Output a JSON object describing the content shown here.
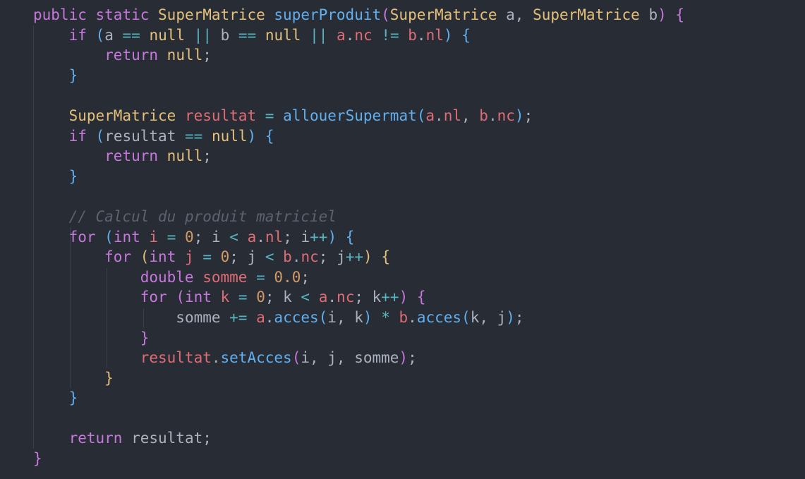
{
  "lines": [
    [
      {
        "t": "public",
        "c": "kw"
      },
      {
        "t": " ",
        "c": "pl"
      },
      {
        "t": "static",
        "c": "kw"
      },
      {
        "t": " ",
        "c": "pl"
      },
      {
        "t": "SuperMatrice",
        "c": "ty"
      },
      {
        "t": " ",
        "c": "pl"
      },
      {
        "t": "superProduit",
        "c": "fn"
      },
      {
        "t": "(",
        "c": "b1"
      },
      {
        "t": "SuperMatrice",
        "c": "ty"
      },
      {
        "t": " a, ",
        "c": "pl"
      },
      {
        "t": "SuperMatrice",
        "c": "ty"
      },
      {
        "t": " b",
        "c": "pl"
      },
      {
        "t": ")",
        "c": "b1"
      },
      {
        "t": " ",
        "c": "pl"
      },
      {
        "t": "{",
        "c": "b1"
      }
    ],
    [
      {
        "t": "    ",
        "c": "pl"
      },
      {
        "t": "if",
        "c": "kw"
      },
      {
        "t": " ",
        "c": "pl"
      },
      {
        "t": "(",
        "c": "b2"
      },
      {
        "t": "a ",
        "c": "pl"
      },
      {
        "t": "==",
        "c": "op"
      },
      {
        "t": " ",
        "c": "pl"
      },
      {
        "t": "null",
        "c": "ty"
      },
      {
        "t": " ",
        "c": "pl"
      },
      {
        "t": "||",
        "c": "op"
      },
      {
        "t": " b ",
        "c": "pl"
      },
      {
        "t": "==",
        "c": "op"
      },
      {
        "t": " ",
        "c": "pl"
      },
      {
        "t": "null",
        "c": "ty"
      },
      {
        "t": " ",
        "c": "pl"
      },
      {
        "t": "||",
        "c": "op"
      },
      {
        "t": " ",
        "c": "pl"
      },
      {
        "t": "a",
        "c": "var"
      },
      {
        "t": ".",
        "c": "pl"
      },
      {
        "t": "nc",
        "c": "var"
      },
      {
        "t": " ",
        "c": "pl"
      },
      {
        "t": "!=",
        "c": "op"
      },
      {
        "t": " ",
        "c": "pl"
      },
      {
        "t": "b",
        "c": "var"
      },
      {
        "t": ".",
        "c": "pl"
      },
      {
        "t": "nl",
        "c": "var"
      },
      {
        "t": ")",
        "c": "b2"
      },
      {
        "t": " ",
        "c": "pl"
      },
      {
        "t": "{",
        "c": "b2"
      }
    ],
    [
      {
        "t": "        ",
        "c": "pl"
      },
      {
        "t": "return",
        "c": "kw"
      },
      {
        "t": " ",
        "c": "pl"
      },
      {
        "t": "null",
        "c": "ty"
      },
      {
        "t": ";",
        "c": "pl"
      }
    ],
    [
      {
        "t": "    ",
        "c": "pl"
      },
      {
        "t": "}",
        "c": "b2"
      }
    ],
    [],
    [
      {
        "t": "    ",
        "c": "pl"
      },
      {
        "t": "SuperMatrice",
        "c": "ty"
      },
      {
        "t": " ",
        "c": "pl"
      },
      {
        "t": "resultat",
        "c": "var"
      },
      {
        "t": " ",
        "c": "pl"
      },
      {
        "t": "=",
        "c": "op"
      },
      {
        "t": " ",
        "c": "pl"
      },
      {
        "t": "allouerSupermat",
        "c": "fn"
      },
      {
        "t": "(",
        "c": "b2"
      },
      {
        "t": "a",
        "c": "var"
      },
      {
        "t": ".",
        "c": "pl"
      },
      {
        "t": "nl",
        "c": "var"
      },
      {
        "t": ", ",
        "c": "pl"
      },
      {
        "t": "b",
        "c": "var"
      },
      {
        "t": ".",
        "c": "pl"
      },
      {
        "t": "nc",
        "c": "var"
      },
      {
        "t": ")",
        "c": "b2"
      },
      {
        "t": ";",
        "c": "pl"
      }
    ],
    [
      {
        "t": "    ",
        "c": "pl"
      },
      {
        "t": "if",
        "c": "kw"
      },
      {
        "t": " ",
        "c": "pl"
      },
      {
        "t": "(",
        "c": "b2"
      },
      {
        "t": "resultat ",
        "c": "pl"
      },
      {
        "t": "==",
        "c": "op"
      },
      {
        "t": " ",
        "c": "pl"
      },
      {
        "t": "null",
        "c": "ty"
      },
      {
        "t": ")",
        "c": "b2"
      },
      {
        "t": " ",
        "c": "pl"
      },
      {
        "t": "{",
        "c": "b2"
      }
    ],
    [
      {
        "t": "        ",
        "c": "pl"
      },
      {
        "t": "return",
        "c": "kw"
      },
      {
        "t": " ",
        "c": "pl"
      },
      {
        "t": "null",
        "c": "ty"
      },
      {
        "t": ";",
        "c": "pl"
      }
    ],
    [
      {
        "t": "    ",
        "c": "pl"
      },
      {
        "t": "}",
        "c": "b2"
      }
    ],
    [],
    [
      {
        "t": "    ",
        "c": "pl"
      },
      {
        "t": "// Calcul du produit matriciel",
        "c": "cm"
      }
    ],
    [
      {
        "t": "    ",
        "c": "pl"
      },
      {
        "t": "for",
        "c": "kw"
      },
      {
        "t": " ",
        "c": "pl"
      },
      {
        "t": "(",
        "c": "b2"
      },
      {
        "t": "int",
        "c": "kw"
      },
      {
        "t": " ",
        "c": "pl"
      },
      {
        "t": "i",
        "c": "var"
      },
      {
        "t": " ",
        "c": "pl"
      },
      {
        "t": "=",
        "c": "op"
      },
      {
        "t": " ",
        "c": "pl"
      },
      {
        "t": "0",
        "c": "num"
      },
      {
        "t": "; i ",
        "c": "pl"
      },
      {
        "t": "<",
        "c": "op"
      },
      {
        "t": " ",
        "c": "pl"
      },
      {
        "t": "a",
        "c": "var"
      },
      {
        "t": ".",
        "c": "pl"
      },
      {
        "t": "nl",
        "c": "var"
      },
      {
        "t": "; i",
        "c": "pl"
      },
      {
        "t": "++",
        "c": "op"
      },
      {
        "t": ")",
        "c": "b2"
      },
      {
        "t": " ",
        "c": "pl"
      },
      {
        "t": "{",
        "c": "b2"
      }
    ],
    [
      {
        "t": "        ",
        "c": "pl"
      },
      {
        "t": "for",
        "c": "kw"
      },
      {
        "t": " ",
        "c": "pl"
      },
      {
        "t": "(",
        "c": "b3"
      },
      {
        "t": "int",
        "c": "kw"
      },
      {
        "t": " ",
        "c": "pl"
      },
      {
        "t": "j",
        "c": "var"
      },
      {
        "t": " ",
        "c": "pl"
      },
      {
        "t": "=",
        "c": "op"
      },
      {
        "t": " ",
        "c": "pl"
      },
      {
        "t": "0",
        "c": "num"
      },
      {
        "t": "; j ",
        "c": "pl"
      },
      {
        "t": "<",
        "c": "op"
      },
      {
        "t": " ",
        "c": "pl"
      },
      {
        "t": "b",
        "c": "var"
      },
      {
        "t": ".",
        "c": "pl"
      },
      {
        "t": "nc",
        "c": "var"
      },
      {
        "t": "; j",
        "c": "pl"
      },
      {
        "t": "++",
        "c": "op"
      },
      {
        "t": ")",
        "c": "b3"
      },
      {
        "t": " ",
        "c": "pl"
      },
      {
        "t": "{",
        "c": "b3"
      }
    ],
    [
      {
        "t": "            ",
        "c": "pl"
      },
      {
        "t": "double",
        "c": "kw"
      },
      {
        "t": " ",
        "c": "pl"
      },
      {
        "t": "somme",
        "c": "var"
      },
      {
        "t": " ",
        "c": "pl"
      },
      {
        "t": "=",
        "c": "op"
      },
      {
        "t": " ",
        "c": "pl"
      },
      {
        "t": "0.0",
        "c": "num"
      },
      {
        "t": ";",
        "c": "pl"
      }
    ],
    [
      {
        "t": "            ",
        "c": "pl"
      },
      {
        "t": "for",
        "c": "kw"
      },
      {
        "t": " ",
        "c": "pl"
      },
      {
        "t": "(",
        "c": "b1"
      },
      {
        "t": "int",
        "c": "kw"
      },
      {
        "t": " ",
        "c": "pl"
      },
      {
        "t": "k",
        "c": "var"
      },
      {
        "t": " ",
        "c": "pl"
      },
      {
        "t": "=",
        "c": "op"
      },
      {
        "t": " ",
        "c": "pl"
      },
      {
        "t": "0",
        "c": "num"
      },
      {
        "t": "; k ",
        "c": "pl"
      },
      {
        "t": "<",
        "c": "op"
      },
      {
        "t": " ",
        "c": "pl"
      },
      {
        "t": "a",
        "c": "var"
      },
      {
        "t": ".",
        "c": "pl"
      },
      {
        "t": "nc",
        "c": "var"
      },
      {
        "t": "; k",
        "c": "pl"
      },
      {
        "t": "++",
        "c": "op"
      },
      {
        "t": ")",
        "c": "b1"
      },
      {
        "t": " ",
        "c": "pl"
      },
      {
        "t": "{",
        "c": "b1"
      }
    ],
    [
      {
        "t": "                ",
        "c": "pl"
      },
      {
        "t": "somme ",
        "c": "pl"
      },
      {
        "t": "+=",
        "c": "op"
      },
      {
        "t": " ",
        "c": "pl"
      },
      {
        "t": "a",
        "c": "var"
      },
      {
        "t": ".",
        "c": "pl"
      },
      {
        "t": "acces",
        "c": "fn"
      },
      {
        "t": "(",
        "c": "b2"
      },
      {
        "t": "i, k",
        "c": "pl"
      },
      {
        "t": ")",
        "c": "b2"
      },
      {
        "t": " ",
        "c": "pl"
      },
      {
        "t": "*",
        "c": "op"
      },
      {
        "t": " ",
        "c": "pl"
      },
      {
        "t": "b",
        "c": "var"
      },
      {
        "t": ".",
        "c": "pl"
      },
      {
        "t": "acces",
        "c": "fn"
      },
      {
        "t": "(",
        "c": "b2"
      },
      {
        "t": "k, j",
        "c": "pl"
      },
      {
        "t": ")",
        "c": "b2"
      },
      {
        "t": ";",
        "c": "pl"
      }
    ],
    [
      {
        "t": "            ",
        "c": "pl"
      },
      {
        "t": "}",
        "c": "b1"
      }
    ],
    [
      {
        "t": "            ",
        "c": "pl"
      },
      {
        "t": "resultat",
        "c": "var"
      },
      {
        "t": ".",
        "c": "pl"
      },
      {
        "t": "setAcces",
        "c": "fn"
      },
      {
        "t": "(",
        "c": "b1"
      },
      {
        "t": "i, j, somme",
        "c": "pl"
      },
      {
        "t": ")",
        "c": "b1"
      },
      {
        "t": ";",
        "c": "pl"
      }
    ],
    [
      {
        "t": "        ",
        "c": "pl"
      },
      {
        "t": "}",
        "c": "b3"
      }
    ],
    [
      {
        "t": "    ",
        "c": "pl"
      },
      {
        "t": "}",
        "c": "b2"
      }
    ],
    [],
    [
      {
        "t": "    ",
        "c": "pl"
      },
      {
        "t": "return",
        "c": "kw"
      },
      {
        "t": " ",
        "c": "pl"
      },
      {
        "t": "resultat",
        "c": "pl"
      },
      {
        "t": ";",
        "c": "pl"
      }
    ],
    [
      {
        "t": "}",
        "c": "b1"
      }
    ]
  ]
}
